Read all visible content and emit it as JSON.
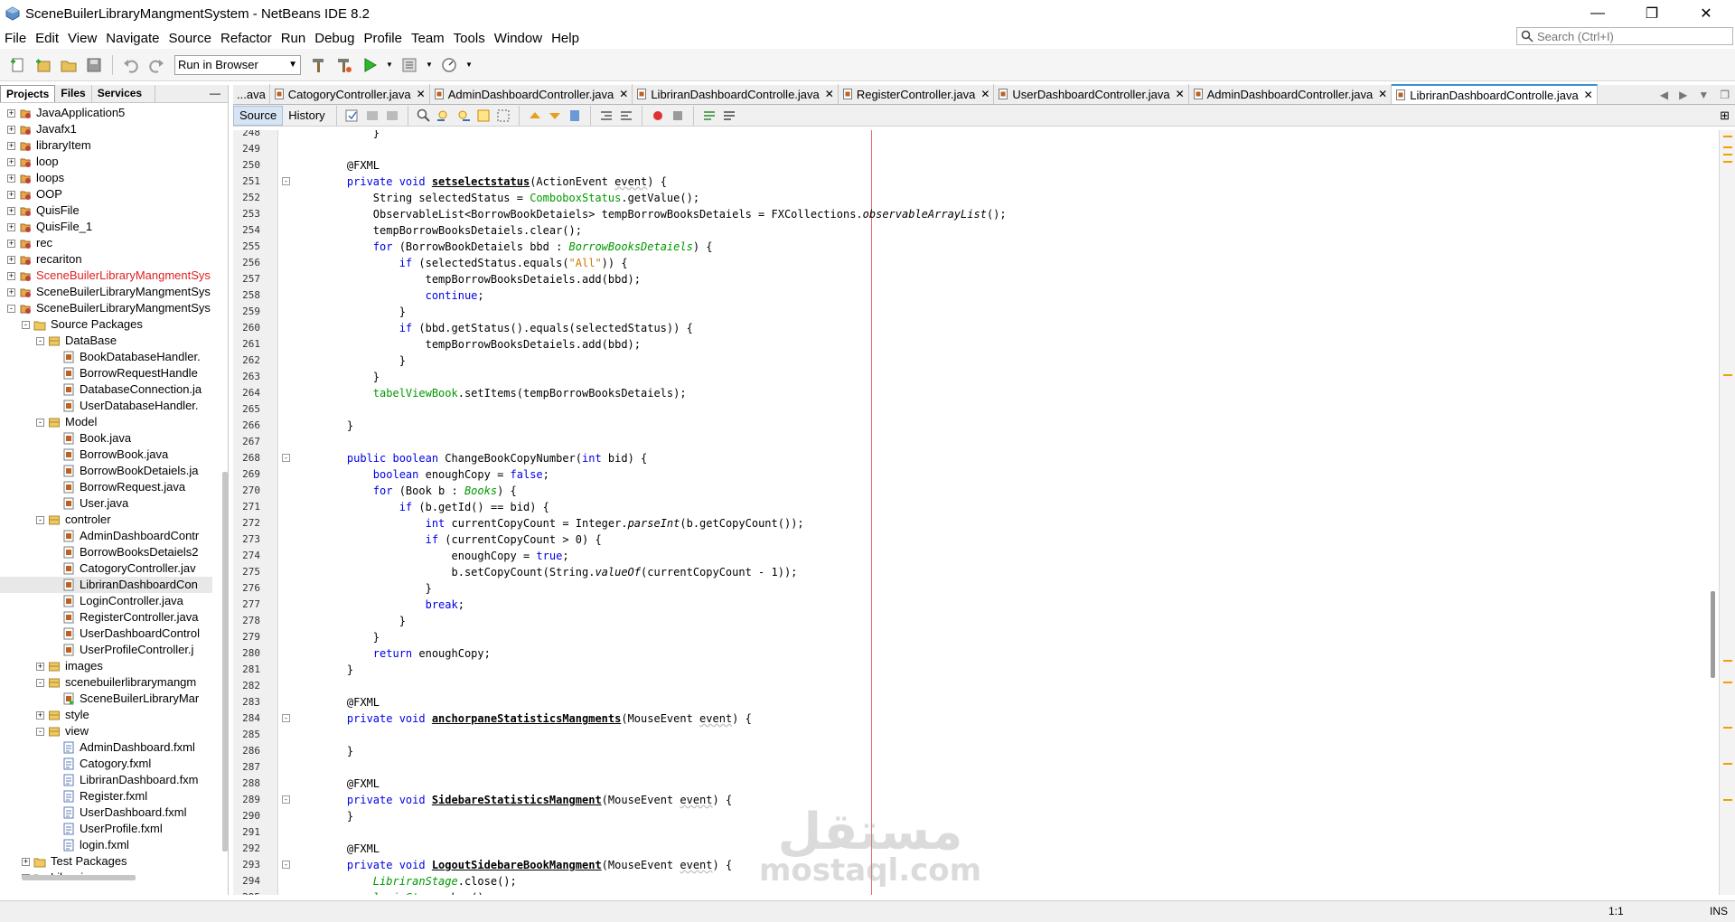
{
  "window": {
    "title": "SceneBuilerLibraryMangmentSystem - NetBeans IDE 8.2",
    "controls": [
      "—",
      "❐",
      "✕"
    ]
  },
  "menu": [
    "File",
    "Edit",
    "View",
    "Navigate",
    "Source",
    "Refactor",
    "Run",
    "Debug",
    "Profile",
    "Team",
    "Tools",
    "Window",
    "Help"
  ],
  "search": {
    "placeholder": "Search (Ctrl+I)"
  },
  "toolbar": {
    "run_target": "Run in Browser"
  },
  "left_panel": {
    "tabs": [
      "Projects",
      "Files",
      "Services"
    ],
    "tree": [
      {
        "label": "JavaApplication5",
        "level": 0,
        "state": "+",
        "icon": "project"
      },
      {
        "label": "Javafx1",
        "level": 0,
        "state": "+",
        "icon": "project"
      },
      {
        "label": "libraryItem",
        "level": 0,
        "state": "+",
        "icon": "project"
      },
      {
        "label": "loop",
        "level": 0,
        "state": "+",
        "icon": "project"
      },
      {
        "label": "loops",
        "level": 0,
        "state": "+",
        "icon": "project"
      },
      {
        "label": "OOP",
        "level": 0,
        "state": "+",
        "icon": "project"
      },
      {
        "label": "QuisFile",
        "level": 0,
        "state": "+",
        "icon": "project"
      },
      {
        "label": "QuisFile_1",
        "level": 0,
        "state": "+",
        "icon": "project"
      },
      {
        "label": "rec",
        "level": 0,
        "state": "+",
        "icon": "project"
      },
      {
        "label": "recariton",
        "level": 0,
        "state": "+",
        "icon": "project"
      },
      {
        "label": "SceneBuilerLibraryMangmentSys",
        "level": 0,
        "state": "+",
        "icon": "project",
        "error": true
      },
      {
        "label": "SceneBuilerLibraryMangmentSys",
        "level": 0,
        "state": "+",
        "icon": "project"
      },
      {
        "label": "SceneBuilerLibraryMangmentSys",
        "level": 0,
        "state": "-",
        "icon": "project"
      },
      {
        "label": "Source Packages",
        "level": 1,
        "state": "-",
        "icon": "folder"
      },
      {
        "label": "DataBase",
        "level": 2,
        "state": "-",
        "icon": "package"
      },
      {
        "label": "BookDatabaseHandler.",
        "level": 3,
        "state": "",
        "icon": "java"
      },
      {
        "label": "BorrowRequestHandle",
        "level": 3,
        "state": "",
        "icon": "java"
      },
      {
        "label": "DatabaseConnection.ja",
        "level": 3,
        "state": "",
        "icon": "java"
      },
      {
        "label": "UserDatabaseHandler.",
        "level": 3,
        "state": "",
        "icon": "java"
      },
      {
        "label": "Model",
        "level": 2,
        "state": "-",
        "icon": "package"
      },
      {
        "label": "Book.java",
        "level": 3,
        "state": "",
        "icon": "java"
      },
      {
        "label": "BorrowBook.java",
        "level": 3,
        "state": "",
        "icon": "java"
      },
      {
        "label": "BorrowBookDetaiels.ja",
        "level": 3,
        "state": "",
        "icon": "java"
      },
      {
        "label": "BorrowRequest.java",
        "level": 3,
        "state": "",
        "icon": "java"
      },
      {
        "label": "User.java",
        "level": 3,
        "state": "",
        "icon": "java"
      },
      {
        "label": "controler",
        "level": 2,
        "state": "-",
        "icon": "package"
      },
      {
        "label": "AdminDashboardContr",
        "level": 3,
        "state": "",
        "icon": "java"
      },
      {
        "label": "BorrowBooksDetaiels2",
        "level": 3,
        "state": "",
        "icon": "java"
      },
      {
        "label": "CatogoryController.jav",
        "level": 3,
        "state": "",
        "icon": "java"
      },
      {
        "label": "LibriranDashboardCon",
        "level": 3,
        "state": "",
        "icon": "java",
        "selected": true
      },
      {
        "label": "LoginController.java",
        "level": 3,
        "state": "",
        "icon": "java"
      },
      {
        "label": "RegisterController.java",
        "level": 3,
        "state": "",
        "icon": "java"
      },
      {
        "label": "UserDashboardControl",
        "level": 3,
        "state": "",
        "icon": "java"
      },
      {
        "label": "UserProfileController.j",
        "level": 3,
        "state": "",
        "icon": "java"
      },
      {
        "label": "images",
        "level": 2,
        "state": "+",
        "icon": "package"
      },
      {
        "label": "scenebuilerlibrarymangm",
        "level": 2,
        "state": "-",
        "icon": "package"
      },
      {
        "label": "SceneBuilerLibraryMar",
        "level": 3,
        "state": "",
        "icon": "javamain"
      },
      {
        "label": "style",
        "level": 2,
        "state": "+",
        "icon": "package"
      },
      {
        "label": "view",
        "level": 2,
        "state": "-",
        "icon": "package"
      },
      {
        "label": "AdminDashboard.fxml",
        "level": 3,
        "state": "",
        "icon": "fxml"
      },
      {
        "label": "Catogory.fxml",
        "level": 3,
        "state": "",
        "icon": "fxml"
      },
      {
        "label": "LibriranDashboard.fxm",
        "level": 3,
        "state": "",
        "icon": "fxml"
      },
      {
        "label": "Register.fxml",
        "level": 3,
        "state": "",
        "icon": "fxml"
      },
      {
        "label": "UserDashboard.fxml",
        "level": 3,
        "state": "",
        "icon": "fxml"
      },
      {
        "label": "UserProfile.fxml",
        "level": 3,
        "state": "",
        "icon": "fxml"
      },
      {
        "label": "login.fxml",
        "level": 3,
        "state": "",
        "icon": "fxml"
      },
      {
        "label": "Test Packages",
        "level": 1,
        "state": "+",
        "icon": "folder"
      },
      {
        "label": "Libraries",
        "level": 1,
        "state": "+",
        "icon": "folder"
      }
    ]
  },
  "editor": {
    "tabs": [
      {
        "label": "...ava",
        "active": false,
        "closable": false
      },
      {
        "label": "CatogoryController.java",
        "active": false,
        "closable": true
      },
      {
        "label": "AdminDashboardController.java",
        "active": false,
        "closable": true
      },
      {
        "label": "LibriranDashboardControlle.java",
        "active": false,
        "closable": true
      },
      {
        "label": "RegisterController.java",
        "active": false,
        "closable": true
      },
      {
        "label": "UserDashboardController.java",
        "active": false,
        "closable": true
      },
      {
        "label": "AdminDashboardController.java",
        "active": false,
        "closable": true
      },
      {
        "label": "LibriranDashboardControlle.java",
        "active": true,
        "closable": true
      }
    ],
    "view_tabs": [
      "Source",
      "History"
    ],
    "first_line_number": 248,
    "lines": [
      {
        "n": 248,
        "fold": "",
        "segs": [
          [
            "n",
            "        }"
          ]
        ]
      },
      {
        "n": 249,
        "fold": "",
        "segs": []
      },
      {
        "n": 250,
        "fold": "",
        "segs": [
          [
            "n",
            "    @FXML"
          ]
        ]
      },
      {
        "n": 251,
        "fold": "-",
        "segs": [
          [
            "k",
            "    private void "
          ],
          [
            "m",
            "setselectstatus"
          ],
          [
            "n",
            "(ActionEvent "
          ],
          [
            "u",
            "event"
          ],
          [
            "n",
            ") {"
          ]
        ]
      },
      {
        "n": 252,
        "fold": "",
        "segs": [
          [
            "n",
            "        String selectedStatus = "
          ],
          [
            "f",
            "ComboboxStatus"
          ],
          [
            "n",
            ".getValue();"
          ]
        ]
      },
      {
        "n": 253,
        "fold": "",
        "segs": [
          [
            "n",
            "        ObservableList<BorrowBookDetaiels> tempBorrowBooksDetaiels = FXCollections."
          ],
          [
            "it",
            "observableArrayList"
          ],
          [
            "n",
            "();"
          ]
        ]
      },
      {
        "n": 254,
        "fold": "",
        "segs": [
          [
            "n",
            "        tempBorrowBooksDetaiels.clear();"
          ]
        ]
      },
      {
        "n": 255,
        "fold": "",
        "segs": [
          [
            "k",
            "        for "
          ],
          [
            "n",
            "(BorrowBookDetaiels bbd : "
          ],
          [
            "fi",
            "BorrowBooksDetaiels"
          ],
          [
            "n",
            ") {"
          ]
        ]
      },
      {
        "n": 256,
        "fold": "",
        "segs": [
          [
            "k",
            "            if "
          ],
          [
            "n",
            "(selectedStatus.equals("
          ],
          [
            "s",
            "\"All\""
          ],
          [
            "n",
            ")) {"
          ]
        ]
      },
      {
        "n": 257,
        "fold": "",
        "segs": [
          [
            "n",
            "                tempBorrowBooksDetaiels.add(bbd);"
          ]
        ]
      },
      {
        "n": 258,
        "fold": "",
        "segs": [
          [
            "k",
            "                continue"
          ],
          [
            "n",
            ";"
          ]
        ]
      },
      {
        "n": 259,
        "fold": "",
        "segs": [
          [
            "n",
            "            }"
          ]
        ]
      },
      {
        "n": 260,
        "fold": "",
        "segs": [
          [
            "k",
            "            if "
          ],
          [
            "n",
            "(bbd.getStatus().equals(selectedStatus)) {"
          ]
        ]
      },
      {
        "n": 261,
        "fold": "",
        "segs": [
          [
            "n",
            "                tempBorrowBooksDetaiels.add(bbd);"
          ]
        ]
      },
      {
        "n": 262,
        "fold": "",
        "segs": [
          [
            "n",
            "            }"
          ]
        ]
      },
      {
        "n": 263,
        "fold": "",
        "segs": [
          [
            "n",
            "        }"
          ]
        ]
      },
      {
        "n": 264,
        "fold": "",
        "segs": [
          [
            "f",
            "        tabelViewBook"
          ],
          [
            "n",
            ".setItems(tempBorrowBooksDetaiels);"
          ]
        ]
      },
      {
        "n": 265,
        "fold": "",
        "segs": []
      },
      {
        "n": 266,
        "fold": "",
        "segs": [
          [
            "n",
            "    }"
          ]
        ]
      },
      {
        "n": 267,
        "fold": "",
        "segs": []
      },
      {
        "n": 268,
        "fold": "-",
        "segs": [
          [
            "k",
            "    public boolean "
          ],
          [
            "n",
            "ChangeBookCopyNumber("
          ],
          [
            "k",
            "int "
          ],
          [
            "n",
            "bid) {"
          ]
        ]
      },
      {
        "n": 269,
        "fold": "",
        "segs": [
          [
            "k",
            "        boolean "
          ],
          [
            "n",
            "enoughCopy = "
          ],
          [
            "k",
            "false"
          ],
          [
            "n",
            ";"
          ]
        ]
      },
      {
        "n": 270,
        "fold": "",
        "segs": [
          [
            "k",
            "        for "
          ],
          [
            "n",
            "(Book b : "
          ],
          [
            "fi",
            "Books"
          ],
          [
            "n",
            ") {"
          ]
        ]
      },
      {
        "n": 271,
        "fold": "",
        "segs": [
          [
            "k",
            "            if "
          ],
          [
            "n",
            "(b.getId() == bid) {"
          ]
        ]
      },
      {
        "n": 272,
        "fold": "",
        "segs": [
          [
            "k",
            "                int "
          ],
          [
            "n",
            "currentCopyCount = Integer."
          ],
          [
            "it",
            "parseInt"
          ],
          [
            "n",
            "(b.getCopyCount());"
          ]
        ]
      },
      {
        "n": 273,
        "fold": "",
        "segs": [
          [
            "k",
            "                if "
          ],
          [
            "n",
            "(currentCopyCount > 0) {"
          ]
        ]
      },
      {
        "n": 274,
        "fold": "",
        "segs": [
          [
            "n",
            "                    enoughCopy = "
          ],
          [
            "k",
            "true"
          ],
          [
            "n",
            ";"
          ]
        ]
      },
      {
        "n": 275,
        "fold": "",
        "segs": [
          [
            "n",
            "                    b.setCopyCount(String."
          ],
          [
            "it",
            "valueOf"
          ],
          [
            "n",
            "(currentCopyCount - 1));"
          ]
        ]
      },
      {
        "n": 276,
        "fold": "",
        "segs": [
          [
            "n",
            "                }"
          ]
        ]
      },
      {
        "n": 277,
        "fold": "",
        "segs": [
          [
            "k",
            "                break"
          ],
          [
            "n",
            ";"
          ]
        ]
      },
      {
        "n": 278,
        "fold": "",
        "segs": [
          [
            "n",
            "            }"
          ]
        ]
      },
      {
        "n": 279,
        "fold": "",
        "segs": [
          [
            "n",
            "        }"
          ]
        ]
      },
      {
        "n": 280,
        "fold": "",
        "segs": [
          [
            "k",
            "        return "
          ],
          [
            "n",
            "enoughCopy;"
          ]
        ]
      },
      {
        "n": 281,
        "fold": "",
        "segs": [
          [
            "n",
            "    }"
          ]
        ]
      },
      {
        "n": 282,
        "fold": "",
        "segs": []
      },
      {
        "n": 283,
        "fold": "",
        "segs": [
          [
            "n",
            "    @FXML"
          ]
        ]
      },
      {
        "n": 284,
        "fold": "-",
        "segs": [
          [
            "k",
            "    private void "
          ],
          [
            "m",
            "anchorpaneStatisticsMangments"
          ],
          [
            "n",
            "(MouseEvent "
          ],
          [
            "u",
            "event"
          ],
          [
            "n",
            ") {"
          ]
        ]
      },
      {
        "n": 285,
        "fold": "",
        "segs": []
      },
      {
        "n": 286,
        "fold": "",
        "segs": [
          [
            "n",
            "    }"
          ]
        ]
      },
      {
        "n": 287,
        "fold": "",
        "segs": []
      },
      {
        "n": 288,
        "fold": "",
        "segs": [
          [
            "n",
            "    @FXML"
          ]
        ]
      },
      {
        "n": 289,
        "fold": "-",
        "segs": [
          [
            "k",
            "    private void "
          ],
          [
            "m",
            "SidebareStatisticsMangment"
          ],
          [
            "n",
            "(MouseEvent "
          ],
          [
            "u",
            "event"
          ],
          [
            "n",
            ") {"
          ]
        ]
      },
      {
        "n": 290,
        "fold": "",
        "segs": [
          [
            "n",
            "    }"
          ]
        ]
      },
      {
        "n": 291,
        "fold": "",
        "segs": []
      },
      {
        "n": 292,
        "fold": "",
        "segs": [
          [
            "n",
            "    @FXML"
          ]
        ]
      },
      {
        "n": 293,
        "fold": "-",
        "segs": [
          [
            "k",
            "    private void "
          ],
          [
            "m",
            "LogoutSidebareBookMangment"
          ],
          [
            "n",
            "(MouseEvent "
          ],
          [
            "u",
            "event"
          ],
          [
            "n",
            ") {"
          ]
        ]
      },
      {
        "n": 294,
        "fold": "",
        "segs": [
          [
            "fi",
            "        LibriranStage"
          ],
          [
            "n",
            ".close();"
          ]
        ]
      },
      {
        "n": 295,
        "fold": "",
        "segs": [
          [
            "fi",
            "        loginStage"
          ],
          [
            "n",
            ".show();"
          ]
        ]
      }
    ]
  },
  "status": {
    "position": "1:1",
    "mode": "INS"
  },
  "watermark": {
    "arabic": "مستقل",
    "latin": "mostaql.com"
  }
}
